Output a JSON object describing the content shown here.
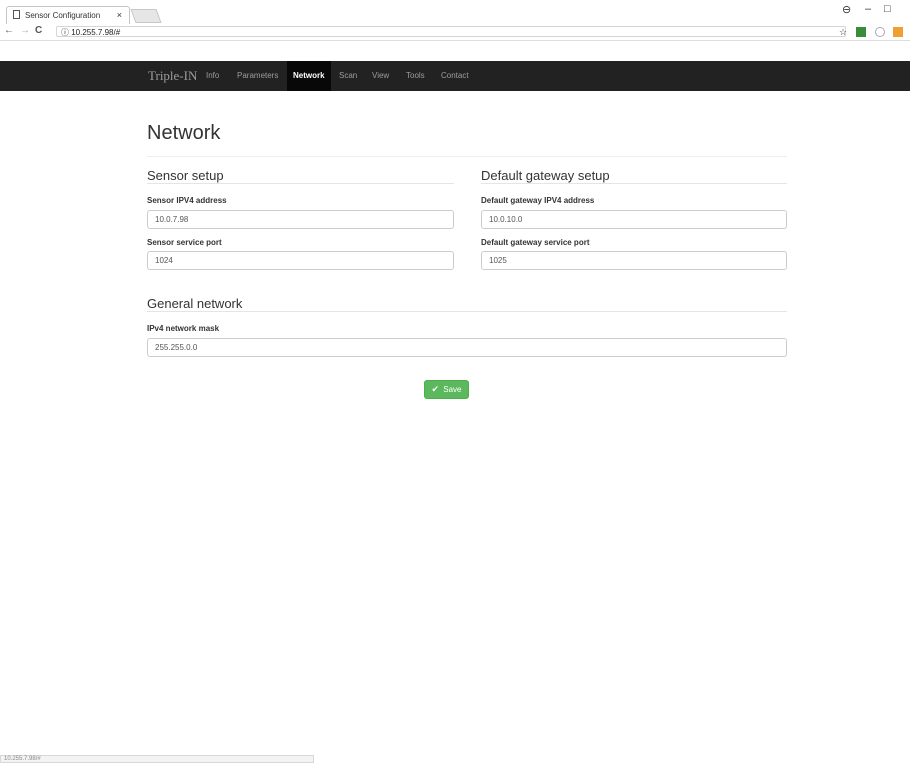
{
  "browser": {
    "tab_title": "Sensor Configuration",
    "tab_close": "×",
    "url": "10.255.7.98/#",
    "info_icon": "ⓘ",
    "back": "←",
    "forward": "→",
    "reload": "C",
    "star": "☆",
    "window_controls": {
      "account": "⊖",
      "minimize": "–",
      "maximize": "□"
    },
    "status_url": "10.255.7.98/#"
  },
  "navbar": {
    "brand": "Triple-IN",
    "items": [
      {
        "label": "Info",
        "active": false
      },
      {
        "label": "Parameters",
        "active": false
      },
      {
        "label": "Network",
        "active": true
      },
      {
        "label": "Scan",
        "active": false
      },
      {
        "label": "View",
        "active": false
      },
      {
        "label": "Tools",
        "active": false
      },
      {
        "label": "Contact",
        "active": false
      }
    ]
  },
  "page": {
    "title": "Network",
    "sensor_setup": {
      "title": "Sensor setup",
      "ip_label": "Sensor IPV4 address",
      "ip_value": "10.0.7.98",
      "port_label": "Sensor service port",
      "port_value": "1024"
    },
    "gateway_setup": {
      "title": "Default gateway setup",
      "ip_label": "Default gateway IPV4 address",
      "ip_value": "10.0.10.0",
      "port_label": "Default gateway service port",
      "port_value": "1025"
    },
    "general": {
      "title": "General network",
      "mask_label": "IPv4 network mask",
      "mask_value": "255.255.0.0"
    },
    "save_label": "Save"
  },
  "colors": {
    "navbar": "#222222",
    "save": "#5cb85c"
  }
}
